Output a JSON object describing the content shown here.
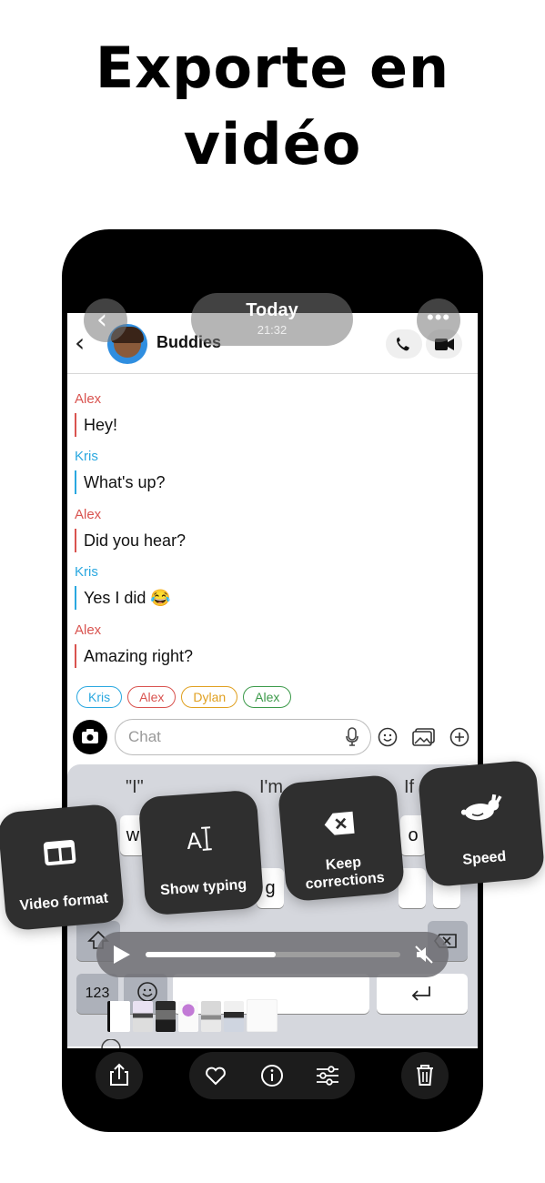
{
  "headline": {
    "line1": "Exporte en",
    "line2": "vidéo"
  },
  "overlay": {
    "date": "Today",
    "time": "21:32"
  },
  "chat": {
    "name": "Buddies",
    "messages": [
      {
        "sender": "Alex",
        "text": "Hey!",
        "color": "#d9534f"
      },
      {
        "sender": "Kris",
        "text": "What's up?",
        "color": "#2aa8e0"
      },
      {
        "sender": "Alex",
        "text": "Did you hear?",
        "color": "#d9534f"
      },
      {
        "sender": "Kris",
        "text": "Yes I did 😂",
        "color": "#2aa8e0"
      },
      {
        "sender": "Alex",
        "text": "Amazing right?",
        "color": "#d9534f"
      }
    ],
    "participants": [
      "Kris",
      "Alex",
      "Dylan",
      "Alex"
    ],
    "input_placeholder": "Chat"
  },
  "keyboard": {
    "suggestions": [
      "\"I\"",
      "I'm",
      "If"
    ],
    "visible_keys": [
      "w",
      "g",
      "o"
    ],
    "numbers_key": "123"
  },
  "features": [
    {
      "label": "Video format",
      "icon": "video-format-icon"
    },
    {
      "label": "Show typing",
      "icon": "show-typing-icon"
    },
    {
      "label": "Keep corrections",
      "icon": "delete-key-icon"
    },
    {
      "label": "Speed",
      "icon": "rabbit-icon"
    }
  ],
  "player": {
    "progress": 0.51,
    "muted": true
  },
  "toolbar": {
    "icons": [
      "share-icon",
      "heart-icon",
      "info-icon",
      "sliders-icon",
      "trash-icon"
    ]
  },
  "colors": {
    "alex": "#d9534f",
    "kris": "#2aa8e0",
    "dylan": "#e0a020",
    "alex_green": "#3c9a4a",
    "card": "#2f2f2f"
  }
}
